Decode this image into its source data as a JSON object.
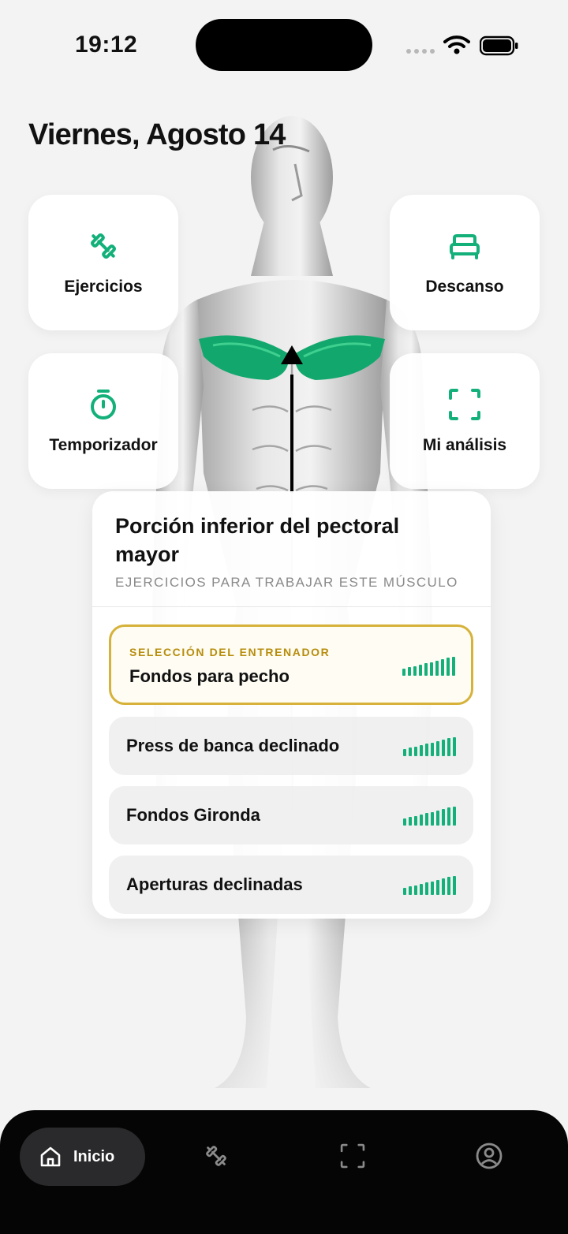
{
  "status_bar": {
    "time": "19:12"
  },
  "header": {
    "date": "Viernes, Agosto 14"
  },
  "tiles": [
    {
      "label": "Ejercicios",
      "icon": "dumbbell-icon"
    },
    {
      "label": "Descanso",
      "icon": "bed-icon"
    },
    {
      "label": "Temporizador",
      "icon": "stopwatch-icon"
    },
    {
      "label": "Mi análisis",
      "icon": "scan-frame-icon"
    }
  ],
  "muscle_card": {
    "title": "Porción inferior del pectoral mayor",
    "subtitle": "EJERCICIOS PARA TRABAJAR ESTE MÚSCULO",
    "featured": {
      "badge": "SELECCIÓN DEL ENTRENADOR",
      "name": "Fondos para pecho",
      "rating": 10,
      "rating_max": 10
    },
    "exercises": [
      {
        "name": "Press de banca declinado",
        "rating": 10,
        "rating_max": 10
      },
      {
        "name": "Fondos Gironda",
        "rating": 10,
        "rating_max": 10
      },
      {
        "name": "Aperturas declinadas",
        "rating": 10,
        "rating_max": 10
      }
    ]
  },
  "nav": {
    "home_label": "Inicio",
    "items": [
      "home-icon",
      "dumbbell-icon",
      "scan-frame-icon",
      "profile-icon"
    ]
  },
  "colors": {
    "accent": "#13b07a",
    "highlight": "#d6b23a",
    "nav_bg": "#050505"
  }
}
